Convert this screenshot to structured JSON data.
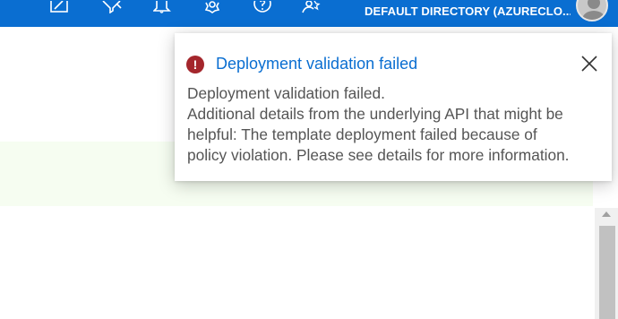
{
  "topbar": {
    "directory_label": "DEFAULT DIRECTORY (AZURECLO...",
    "icons": [
      "edit-icon",
      "filter-icon",
      "notifications-icon",
      "settings-icon",
      "help-icon",
      "feedback-icon"
    ]
  },
  "notification": {
    "title": "Deployment validation failed",
    "message_lines": [
      "Deployment validation failed.",
      "Additional details from the underlying API that might be",
      "helpful: The template deployment failed because of",
      "policy violation. Please see details for more information."
    ],
    "icon": "error-icon",
    "status_color": "#a4262c"
  },
  "colors": {
    "topbar": "#0a6ed1",
    "accent": "#0a6ed1",
    "band": "#f6fdf1"
  }
}
